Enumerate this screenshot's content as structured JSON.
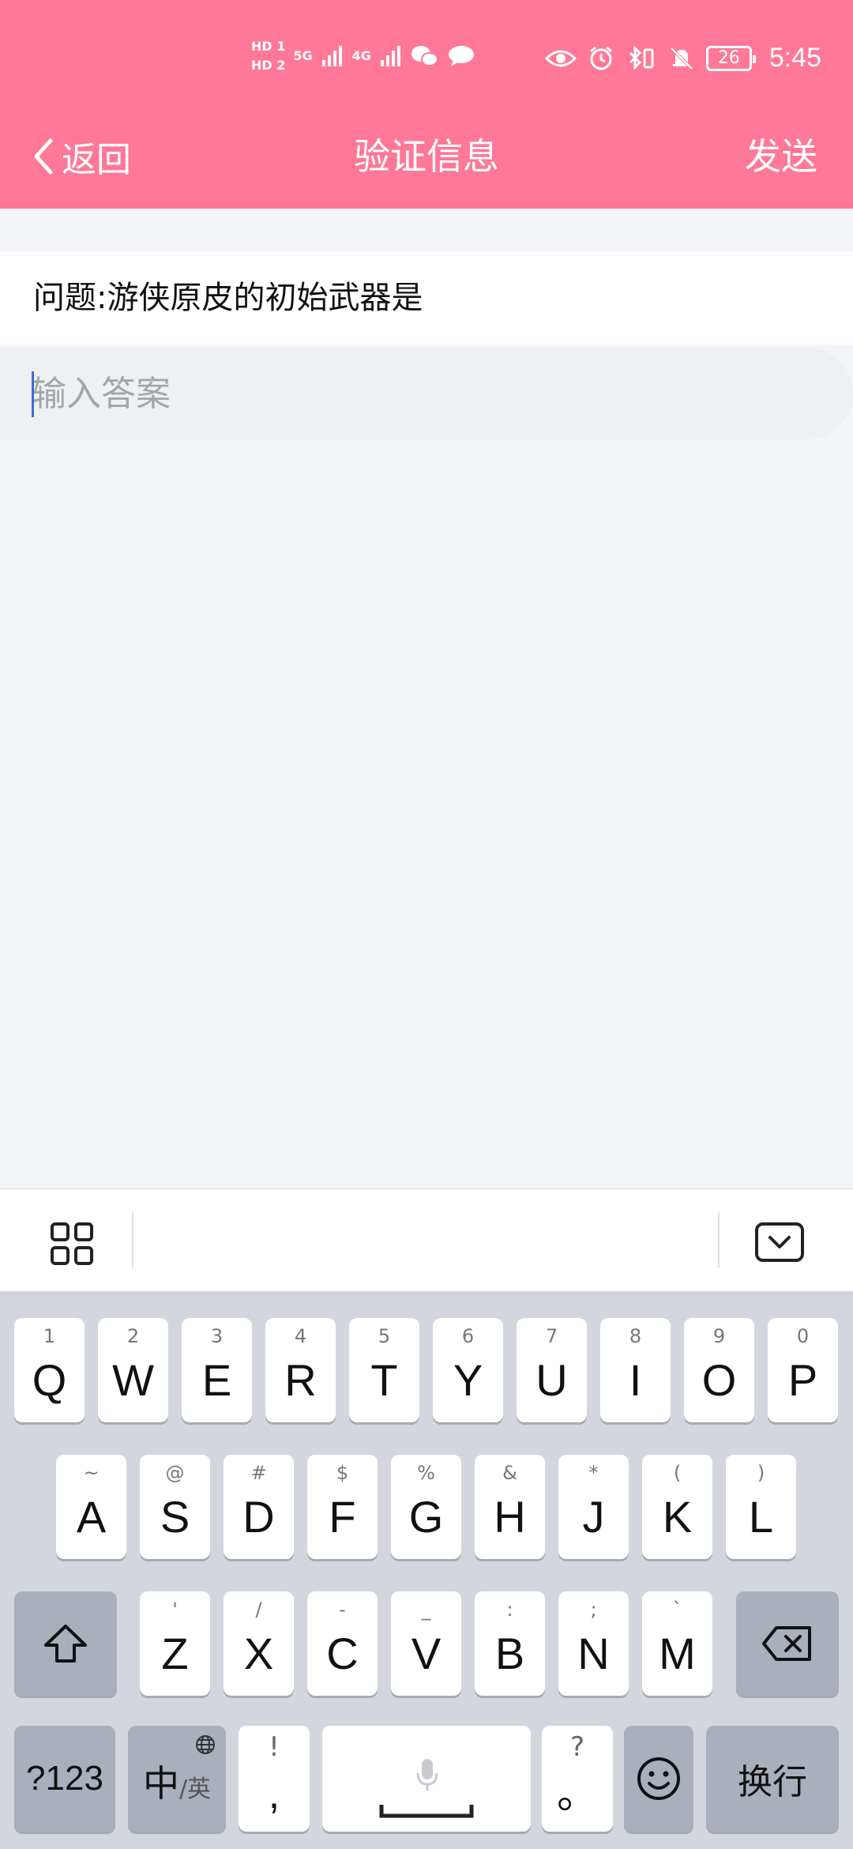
{
  "status_bar": {
    "sim1": "HD 1",
    "sim2": "HD 2",
    "network1": "5G",
    "network2": "4G",
    "battery": "26",
    "time": "5:45"
  },
  "header": {
    "back_label": "返回",
    "title": "验证信息",
    "send_label": "发送",
    "color": "#ff7897"
  },
  "question": {
    "text": "问题:游侠原皮的初始武器是"
  },
  "answer": {
    "placeholder": "输入答案",
    "value": ""
  },
  "keyboard": {
    "row1": [
      {
        "hint": "1",
        "key": "Q"
      },
      {
        "hint": "2",
        "key": "W"
      },
      {
        "hint": "3",
        "key": "E"
      },
      {
        "hint": "4",
        "key": "R"
      },
      {
        "hint": "5",
        "key": "T"
      },
      {
        "hint": "6",
        "key": "Y"
      },
      {
        "hint": "7",
        "key": "U"
      },
      {
        "hint": "8",
        "key": "I"
      },
      {
        "hint": "9",
        "key": "O"
      },
      {
        "hint": "0",
        "key": "P"
      }
    ],
    "row2": [
      {
        "hint": "~",
        "key": "A"
      },
      {
        "hint": "@",
        "key": "S"
      },
      {
        "hint": "#",
        "key": "D"
      },
      {
        "hint": "$",
        "key": "F"
      },
      {
        "hint": "%",
        "key": "G"
      },
      {
        "hint": "&",
        "key": "H"
      },
      {
        "hint": "*",
        "key": "J"
      },
      {
        "hint": "(",
        "key": "K"
      },
      {
        "hint": ")",
        "key": "L"
      }
    ],
    "row3": [
      {
        "hint": "'",
        "key": "Z"
      },
      {
        "hint": "/",
        "key": "X"
      },
      {
        "hint": "-",
        "key": "C"
      },
      {
        "hint": "_",
        "key": "V"
      },
      {
        "hint": ":",
        "key": "B"
      },
      {
        "hint": ";",
        "key": "N"
      },
      {
        "hint": "`",
        "key": "M"
      }
    ],
    "numbers_label": "?123",
    "lang_main": "中",
    "lang_sub": "/英",
    "comma_hint": "!",
    "comma_key": ",",
    "period_hint": "?",
    "period_key": "。",
    "enter_label": "换行"
  }
}
